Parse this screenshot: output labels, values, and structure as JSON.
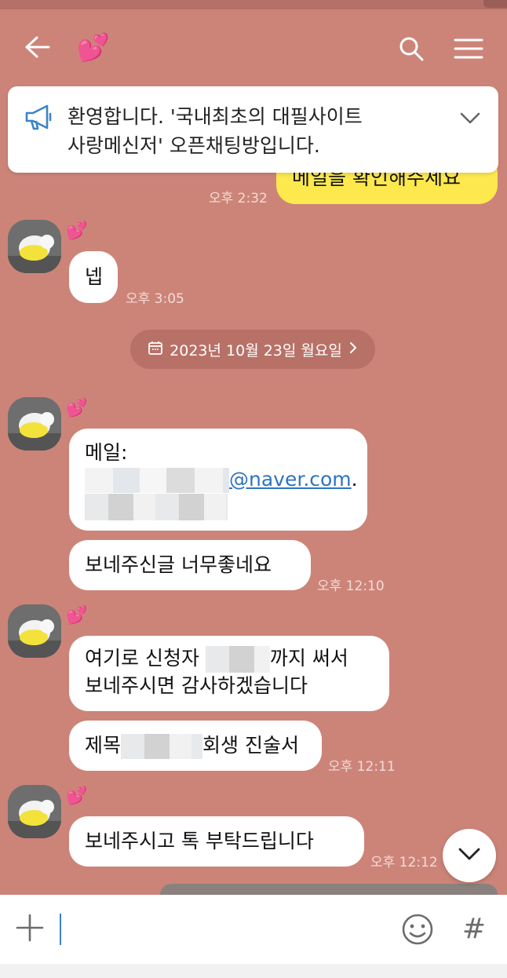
{
  "header": {
    "back_label": "←",
    "room_icon": "💕"
  },
  "notice": {
    "text_line1": "환영합니다. '국내최초의 대필사이트",
    "text_line2": "사랑메신저' 오픈채팅방입니다."
  },
  "messages": {
    "m0": {
      "text": "메일을 확인해주세요",
      "time": "오후 2:32"
    },
    "m1": {
      "sender_icon": "💕",
      "text": "넵",
      "time": "오후 3:05"
    },
    "date_separator": "2023년 10월 23일 월요일",
    "m2": {
      "sender_icon": "💕",
      "label": "메일:",
      "email_domain": "@naver.com",
      "suffix": "."
    },
    "m3": {
      "text": "보네주신글 너무좋네요",
      "time": "오후 12:10"
    },
    "m4": {
      "sender_icon": "💕",
      "line1_start": "여기로 신청자 ",
      "line1_end": "까지 써서",
      "line2": "보네주시면 감사하겠습니다"
    },
    "m5": {
      "prefix": "제목",
      "suffix": "회생 진술서",
      "time": "오후 12:11"
    },
    "m6": {
      "sender_icon": "💕",
      "text": "보네주시고 톡 부탁드립니다",
      "time": "오후 12:12"
    }
  },
  "input": {
    "hash_label": "#"
  },
  "colors": {
    "background": "#cc8479",
    "my_bubble": "#fde84d",
    "heart": "#ff3e8c"
  }
}
